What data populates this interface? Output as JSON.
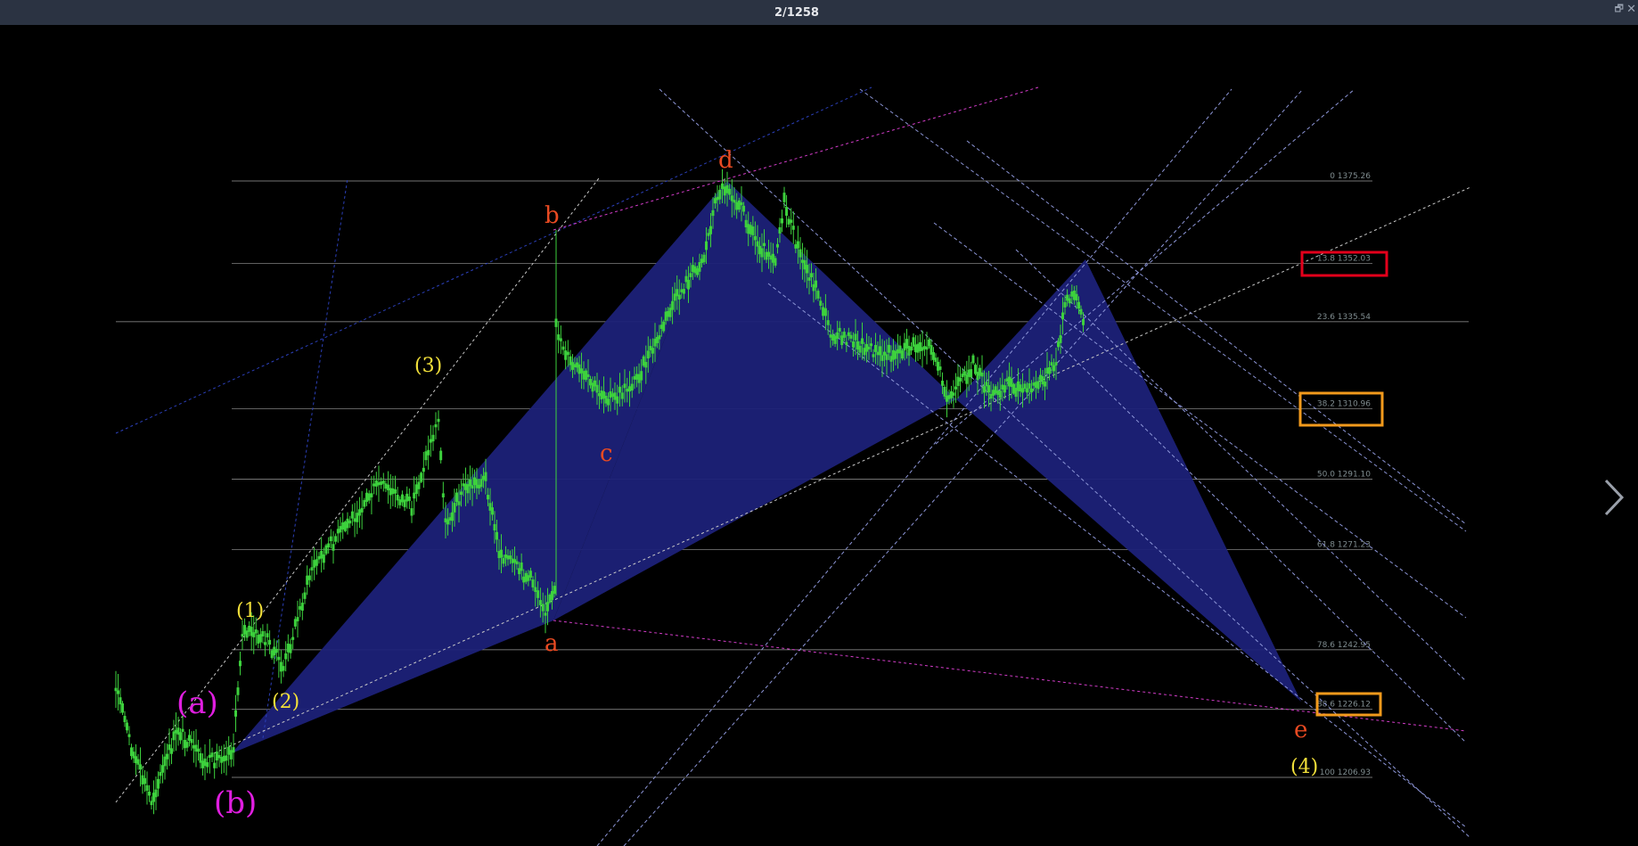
{
  "window": {
    "title": "2/1258"
  },
  "icons": {
    "restore": "restore-icon",
    "close": "close-icon",
    "next": "chevron-right-icon"
  },
  "colors": {
    "background": "#000000",
    "titlebar": "#2b3342",
    "pattern_fill": "#1c2178",
    "candle": "#3dd13d",
    "wave_red": "#e84a22",
    "wave_yellow": "#f2e03a",
    "wave_magenta": "#e01ee0",
    "fib_line": "#9a9a9a",
    "fib_text": "#7f8c8f",
    "box_red": "#e3001b",
    "box_orange": "#f29a1c"
  },
  "fib_levels": [
    {
      "ratio": 0,
      "price": 1375.26,
      "label": "0 1375.26"
    },
    {
      "ratio": 13.8,
      "price": 1352.03,
      "label": "13.8 1352.03"
    },
    {
      "ratio": 23.6,
      "price": 1335.54,
      "label": "23.6 1335.54"
    },
    {
      "ratio": 38.2,
      "price": 1310.96,
      "label": "38.2 1310.96"
    },
    {
      "ratio": 50.0,
      "price": 1291.1,
      "label": "50.0 1291.10"
    },
    {
      "ratio": 61.8,
      "price": 1271.23,
      "label": "61.8 1271.23"
    },
    {
      "ratio": 78.6,
      "price": 1242.95,
      "label": "78.6 1242.95"
    },
    {
      "ratio": 88.6,
      "price": 1226.12,
      "label": "88.6 1226.12"
    },
    {
      "ratio": 100,
      "price": 1206.93,
      "label": "100 1206.93"
    }
  ],
  "wave_labels": {
    "a": "a",
    "b": "b",
    "c": "c",
    "d": "d",
    "e": "e",
    "w1": "(1)",
    "w2": "(2)",
    "w3": "(3)",
    "w4": "(4)",
    "wa": "(a)",
    "wb": "(b)"
  }
}
